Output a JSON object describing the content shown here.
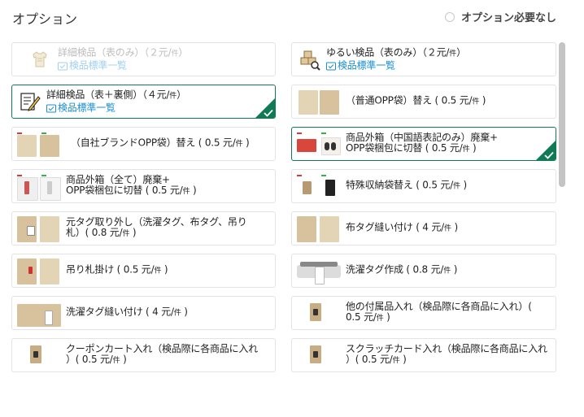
{
  "header": {
    "title": "オプション",
    "no_option_label": "オプション必要なし"
  },
  "common": {
    "unit": "件",
    "link_label": "検品標準一覧"
  },
  "colors": {
    "selected_border": "#0f7a55",
    "link": "#1a8fd6",
    "disabled_text": "#bdbdbd"
  },
  "options": [
    {
      "label": "詳細検品（表のみ）（２元/",
      "tail": "）",
      "has_link": true,
      "state": "disabled",
      "icon": "shirt-icon"
    },
    {
      "label": "ゆるい検品（表のみ）（２元/",
      "tail": "）",
      "has_link": true,
      "state": "normal",
      "icon": "boxes-magnifier-icon"
    },
    {
      "label": "詳細検品（表＋裏側）（４元/",
      "tail": "）",
      "has_link": true,
      "state": "selected",
      "icon": "clipboard-pencil-icon"
    },
    {
      "label": "（普通OPP袋）替え ( 0.5 元/",
      "tail": " )",
      "has_link": false,
      "state": "normal",
      "icon": "opp-bag-icon"
    },
    {
      "label": "（自社ブランドOPP袋）替え ( 0.5 元/",
      "tail": " )",
      "has_link": false,
      "state": "normal",
      "icon": "brand-bag-icon"
    },
    {
      "label": "商品外箱（中国語表記のみ）廃棄+",
      "label2": "OPP袋梱包に切替 ( 0.5 元/",
      "tail": " )",
      "has_link": false,
      "state": "selected",
      "icon": "box-discard-icon"
    },
    {
      "label": "商品外箱（全て）廃棄+",
      "label2": "OPP袋梱包に切替 ( 0.5 元/",
      "tail": " )",
      "has_link": false,
      "state": "normal",
      "icon": "box-all-discard-icon"
    },
    {
      "label": "特殊収納袋替え ( 0.5 元/",
      "tail": " )",
      "has_link": false,
      "state": "normal",
      "icon": "special-bag-icon"
    },
    {
      "label": "元タグ取り外し（洗濯タグ、布タグ、吊り",
      "label2": "札）( 0.8 元/",
      "tail": " )",
      "has_link": false,
      "state": "normal",
      "icon": "tag-removal-icon"
    },
    {
      "label": "布タグ縫い付け ( 4 元/",
      "tail": " )",
      "has_link": false,
      "state": "normal",
      "icon": "fabric-tag-icon"
    },
    {
      "label": "吊り札掛け ( 0.5 元/",
      "tail": " )",
      "has_link": false,
      "state": "normal",
      "icon": "hang-tag-icon"
    },
    {
      "label": "洗濯タグ作成 ( 0.8 元/",
      "tail": " )",
      "has_link": false,
      "state": "normal",
      "icon": "laundry-tag-maker-icon"
    },
    {
      "label": "洗濯タグ縫い付け ( 4 元/",
      "tail": " )",
      "has_link": false,
      "state": "normal",
      "icon": "laundry-tag-sew-icon"
    },
    {
      "label": "他の付属品入れ（検品際に各商品に入れ）(",
      "label2": "0.5 元/",
      "tail": " )",
      "has_link": false,
      "state": "normal",
      "icon": "accessory-insert-icon"
    },
    {
      "label": "クーポンカート入れ（検品際に各商品に入れ",
      "label2": "）( 0.5 元/",
      "tail": " )",
      "has_link": false,
      "state": "normal",
      "icon": "coupon-card-icon"
    },
    {
      "label": "スクラッチカード入れ（検品際に各商品に入れ",
      "label2": "）( 0.5 元/",
      "tail": " )",
      "has_link": false,
      "state": "normal",
      "icon": "scratch-card-icon"
    }
  ]
}
